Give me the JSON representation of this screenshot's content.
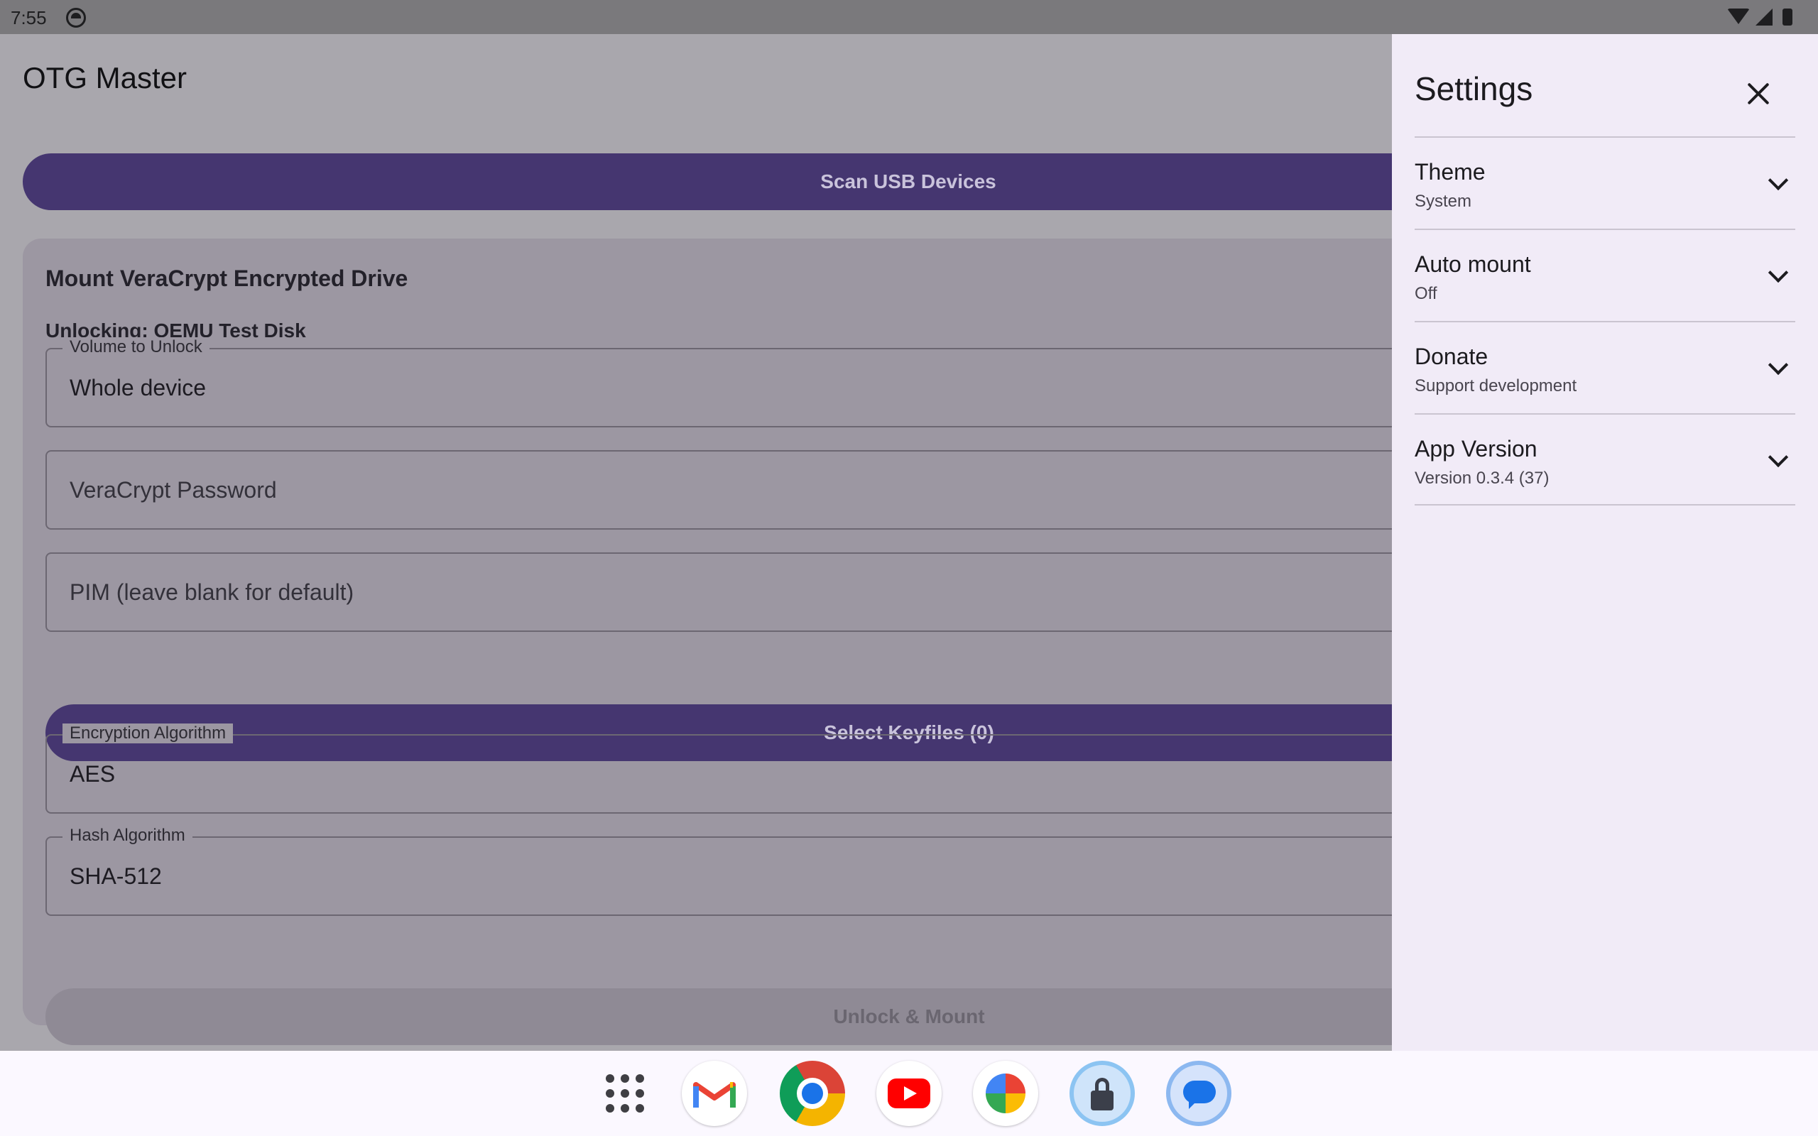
{
  "status_bar": {
    "time": "7:55"
  },
  "app": {
    "title": "OTG Master",
    "scan_button": "Scan USB Devices",
    "card": {
      "title": "Mount VeraCrypt Encrypted Drive",
      "unlocking": "Unlocking: QEMU Test Disk",
      "volume_field": {
        "label": "Volume to Unlock",
        "value": "Whole device"
      },
      "password_field": {
        "placeholder": "VeraCrypt Password"
      },
      "pim_field": {
        "placeholder": "PIM (leave blank for default)"
      },
      "keyfiles_button": "Select Keyfiles (0)",
      "encryption_field": {
        "label": "Encryption Algorithm",
        "value": "AES"
      },
      "hash_field": {
        "label": "Hash Algorithm",
        "value": "SHA-512"
      },
      "unlock_button": "Unlock & Mount"
    }
  },
  "settings": {
    "title": "Settings",
    "items": [
      {
        "title": "Theme",
        "subtitle": "System"
      },
      {
        "title": "Auto mount",
        "subtitle": "Off"
      },
      {
        "title": "Donate",
        "subtitle": "Support development"
      },
      {
        "title": "App Version",
        "subtitle": "Version 0.3.4 (37)"
      }
    ]
  },
  "taskbar": {
    "apps": [
      "apps-grid-icon",
      "gmail-icon",
      "chrome-icon",
      "youtube-icon",
      "photos-icon",
      "otg-master-icon",
      "messages-icon"
    ]
  },
  "colors": {
    "primary_button": "#453670",
    "app_scrim": "#a9a7ad",
    "card": "#9c97a2",
    "settings_panel": "#f1ebf7"
  }
}
